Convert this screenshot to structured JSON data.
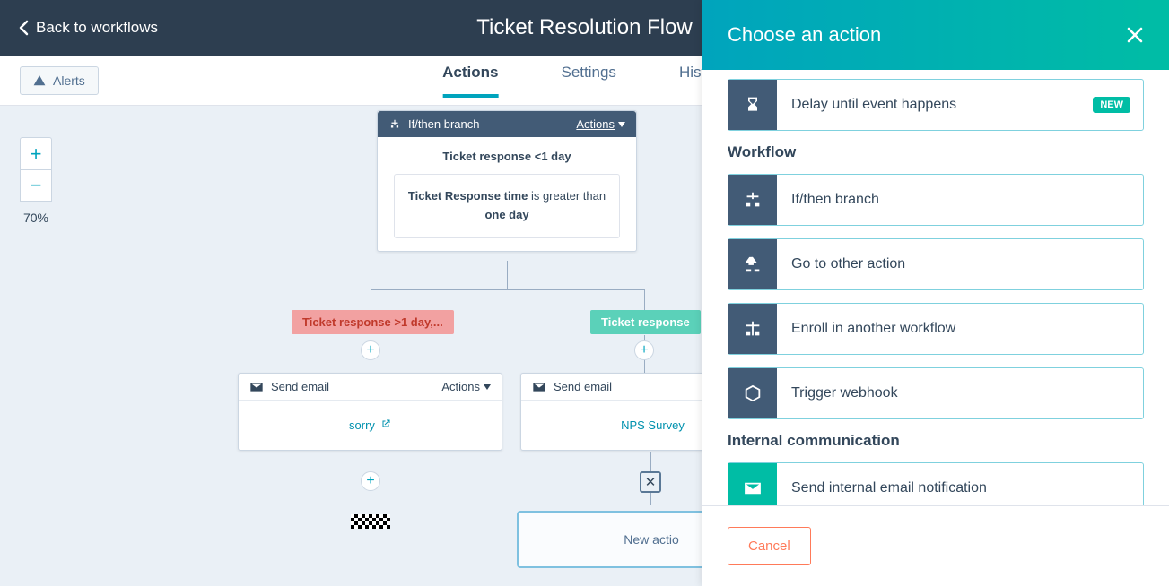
{
  "header": {
    "back_label": "Back to workflows",
    "title": "Ticket Resolution Flow"
  },
  "subhead": {
    "alerts_label": "Alerts",
    "tabs": {
      "actions": "Actions",
      "settings": "Settings",
      "history": "History"
    }
  },
  "zoom": {
    "level": "70%"
  },
  "branch_card": {
    "header_label": "If/then branch",
    "actions_label": "Actions",
    "condition_title": "Ticket response <1 day",
    "condition_prefix": "Ticket Response time",
    "condition_middle": " is greater than ",
    "condition_strong": "one day"
  },
  "branch_labels": {
    "left": "Ticket response >1 day,...",
    "right": "Ticket response"
  },
  "email_cards": {
    "header_label": "Send email",
    "actions_label": "Actions",
    "left_link": "sorry",
    "right_link": "NPS Survey"
  },
  "new_action_box": "New actio",
  "panel": {
    "title": "Choose an action",
    "new_badge": "NEW",
    "rows": {
      "delay": "Delay until event happens"
    },
    "section_workflow": "Workflow",
    "workflow_rows": {
      "ifthen": "If/then branch",
      "goto": "Go to other action",
      "enroll": "Enroll in another workflow",
      "webhook": "Trigger webhook"
    },
    "section_internal": "Internal communication",
    "internal_rows": {
      "email": "Send internal email notification"
    },
    "cancel": "Cancel"
  }
}
